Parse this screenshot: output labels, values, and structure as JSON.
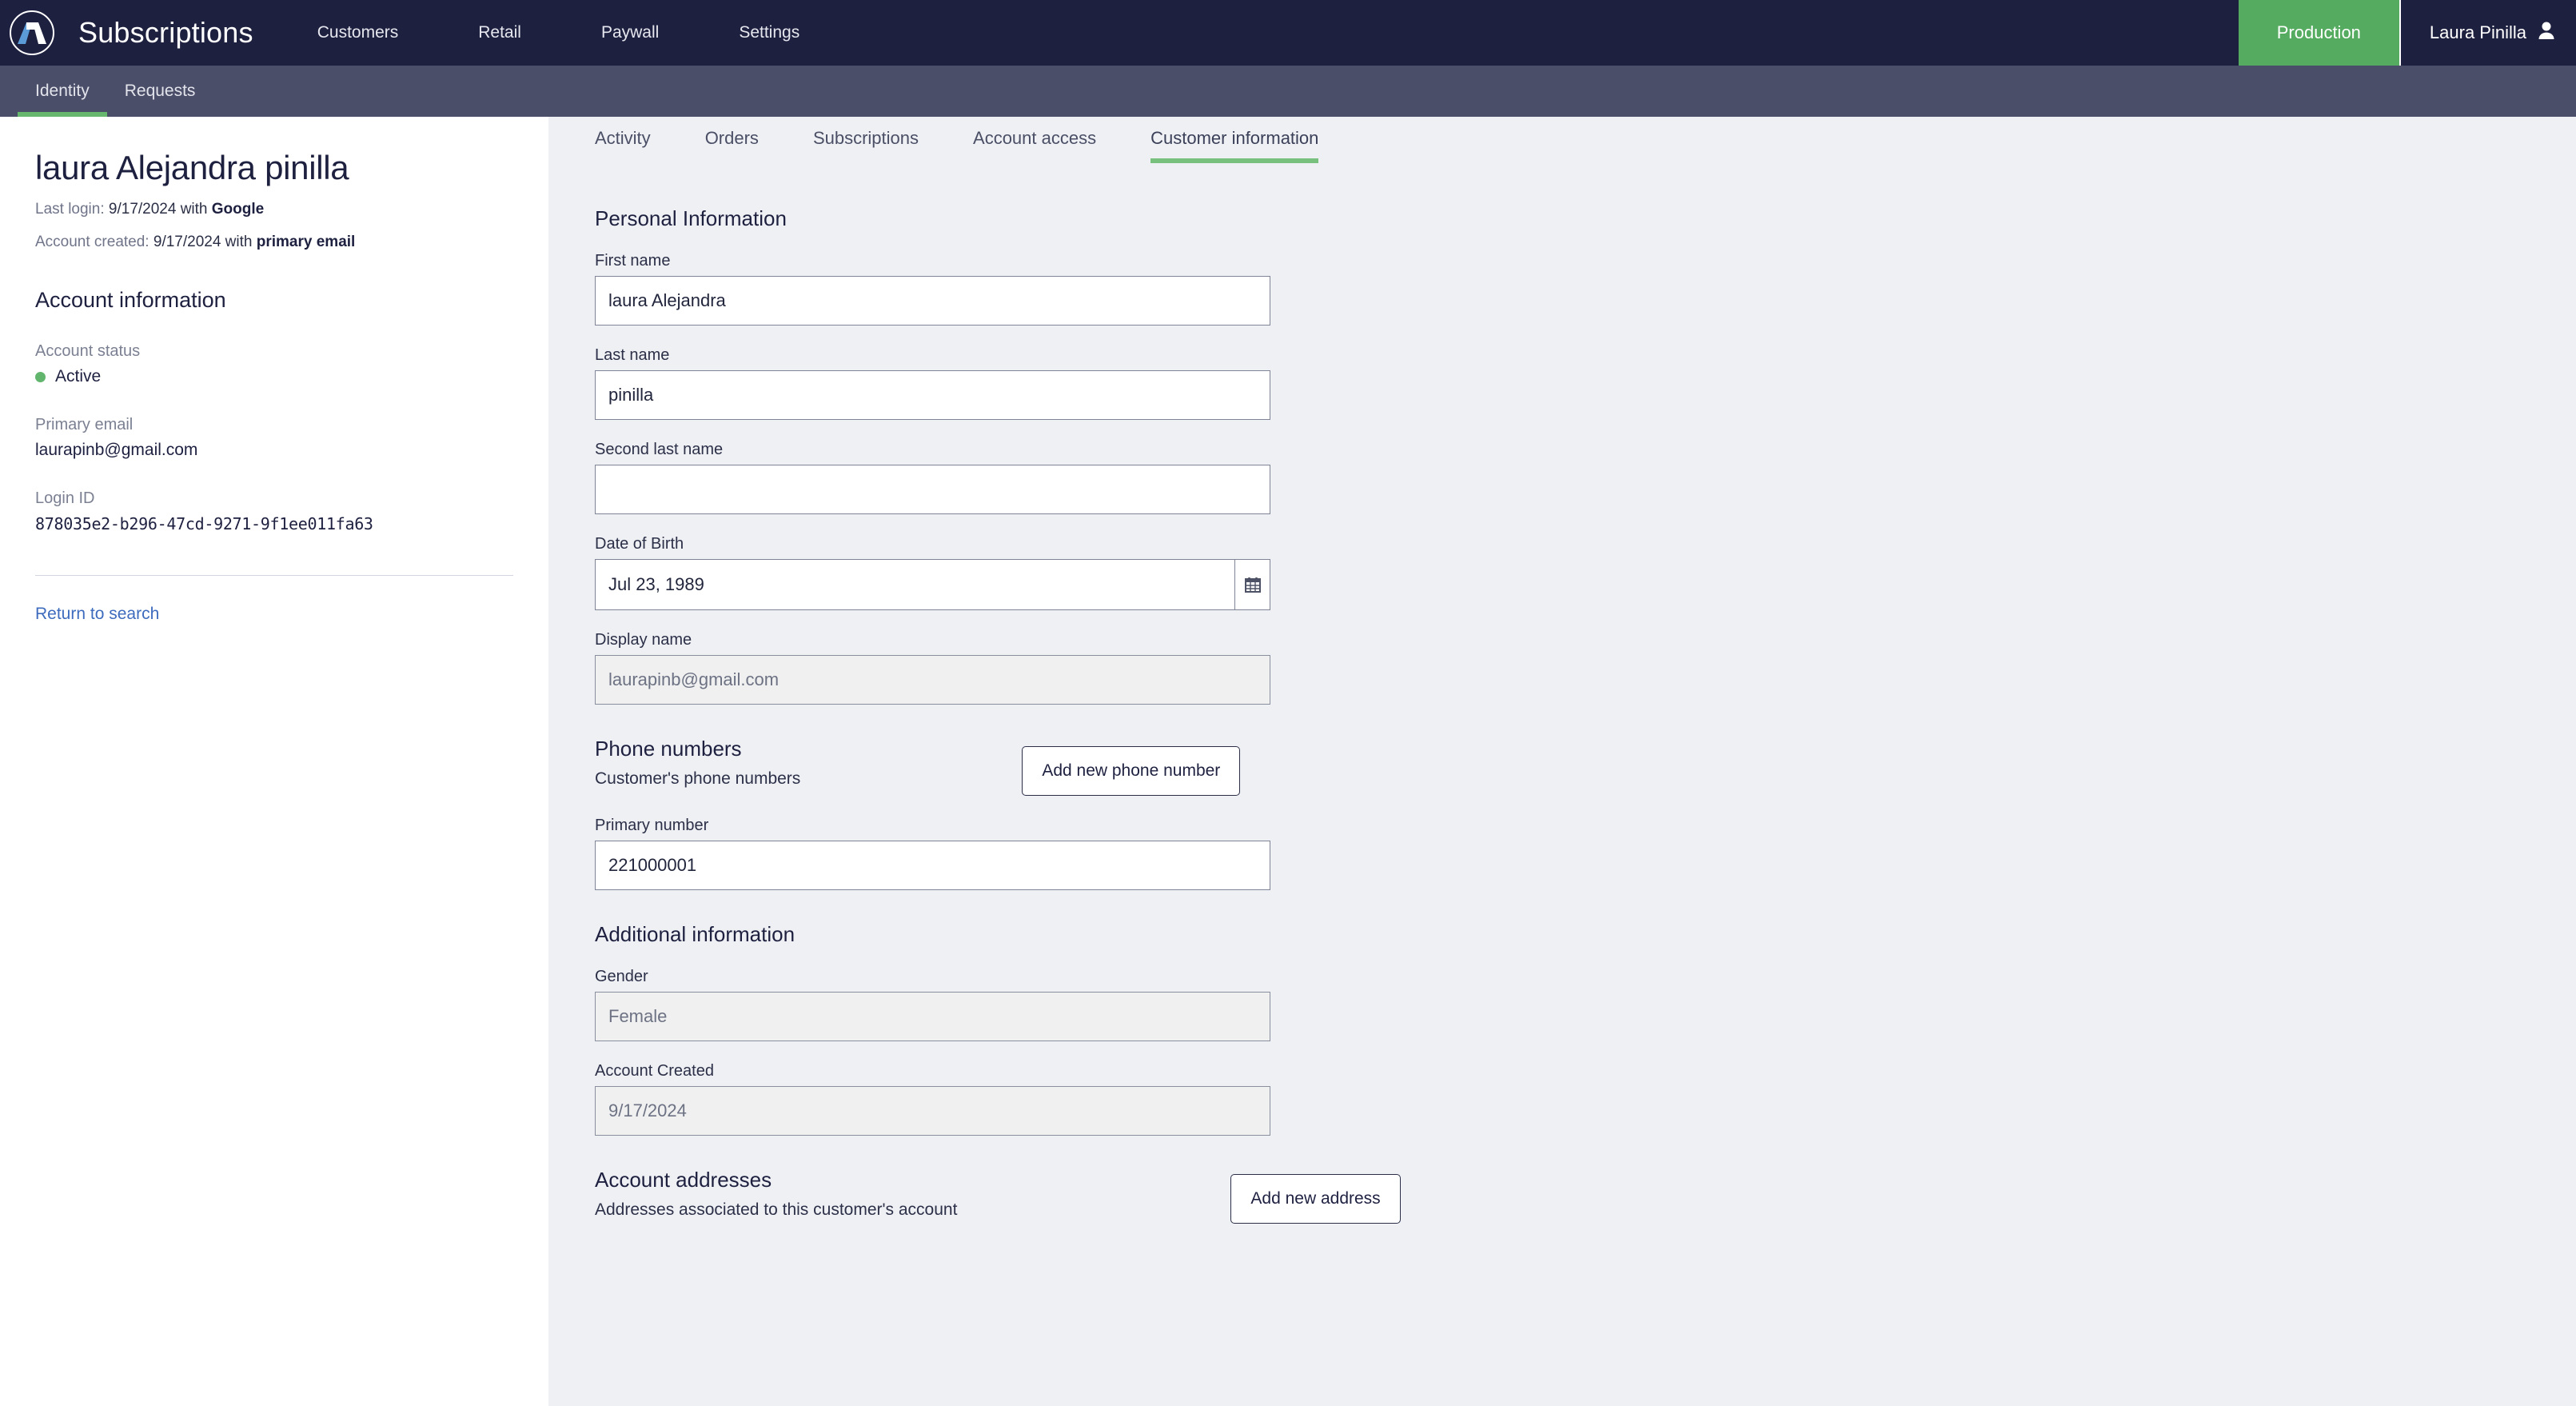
{
  "topbar": {
    "logo_alt": "app-logo",
    "app_title": "Subscriptions",
    "nav": [
      {
        "label": "Customers"
      },
      {
        "label": "Retail"
      },
      {
        "label": "Paywall"
      },
      {
        "label": "Settings"
      }
    ],
    "environment": "Production",
    "user_name": "Laura Pinilla",
    "green": "#55ab5f",
    "bar_color": "#1e2040"
  },
  "subbar": {
    "tabs": [
      {
        "label": "Identity",
        "active": true
      },
      {
        "label": "Requests",
        "active": false
      }
    ],
    "bar_color": "#4a4e68",
    "indicator_color": "#68b76f"
  },
  "sidebar": {
    "customer_name": "laura Alejandra pinilla",
    "last_login_label": "Last login:",
    "last_login_date": "9/17/2024 with",
    "last_login_method": "Google",
    "account_created_label": "Account created:",
    "account_created_date": "9/17/2024 with",
    "account_created_method": "primary email",
    "account_info_title": "Account information",
    "account_status_label": "Account status",
    "account_status_value": "Active",
    "account_status_color": "#62b56c",
    "primary_email_label": "Primary email",
    "primary_email_value": "laurapinb@gmail.com",
    "login_id_label": "Login ID",
    "login_id_value": "878035e2-b296-47cd-9271-9f1ee011fa63",
    "return_link": "Return to search"
  },
  "main": {
    "tabs": [
      {
        "label": "Activity",
        "active": false
      },
      {
        "label": "Orders",
        "active": false
      },
      {
        "label": "Subscriptions",
        "active": false
      },
      {
        "label": "Account access",
        "active": false
      },
      {
        "label": "Customer information",
        "active": true
      }
    ],
    "personal": {
      "title": "Personal Information",
      "first_name_label": "First name",
      "first_name_value": "laura Alejandra",
      "last_name_label": "Last name",
      "last_name_value": "pinilla",
      "second_last_name_label": "Second last name",
      "second_last_name_value": "",
      "dob_label": "Date of Birth",
      "dob_value": "Jul 23, 1989",
      "dob_icon": "calendar-icon",
      "display_name_label": "Display name",
      "display_name_value": "laurapinb@gmail.com"
    },
    "phones": {
      "title": "Phone numbers",
      "subtitle": "Customer's phone numbers",
      "add_button": "Add new phone number",
      "primary_label": "Primary number",
      "primary_value": "221000001"
    },
    "additional": {
      "title": "Additional information",
      "gender_label": "Gender",
      "gender_value": "Female",
      "account_created_label": "Account Created",
      "account_created_value": "9/17/2024"
    },
    "addresses": {
      "title": "Account addresses",
      "subtitle": "Addresses associated to this customer's account",
      "add_button": "Add new address"
    }
  }
}
